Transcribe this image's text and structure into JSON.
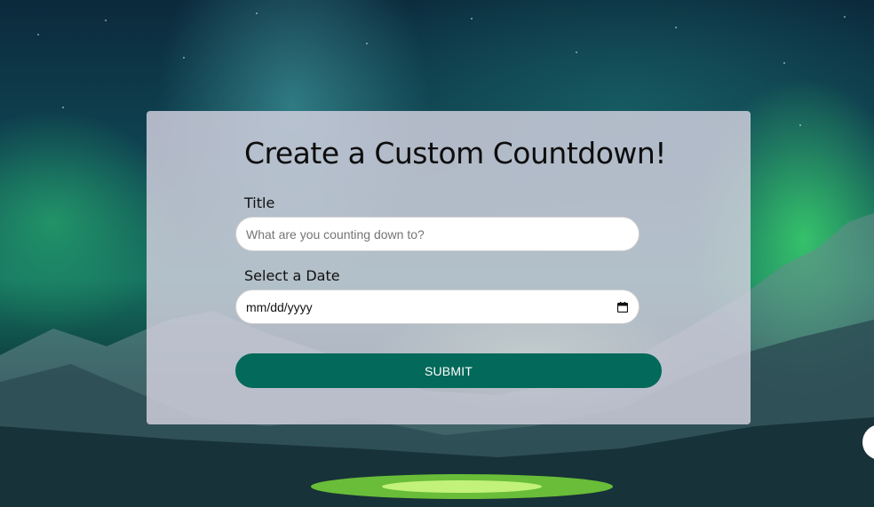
{
  "page": {
    "heading": "Create a Custom Countdown!"
  },
  "form": {
    "title_label": "Title",
    "title_placeholder": "What are you counting down to?",
    "date_label": "Select a Date",
    "date_value": "mm/dd/yyyy",
    "submit_label": "SUBMIT"
  },
  "icons": {
    "date_picker": "calendar-icon"
  },
  "colors": {
    "accent": "#03695a",
    "card": "#d6d2e0",
    "input": "#ffffff"
  }
}
